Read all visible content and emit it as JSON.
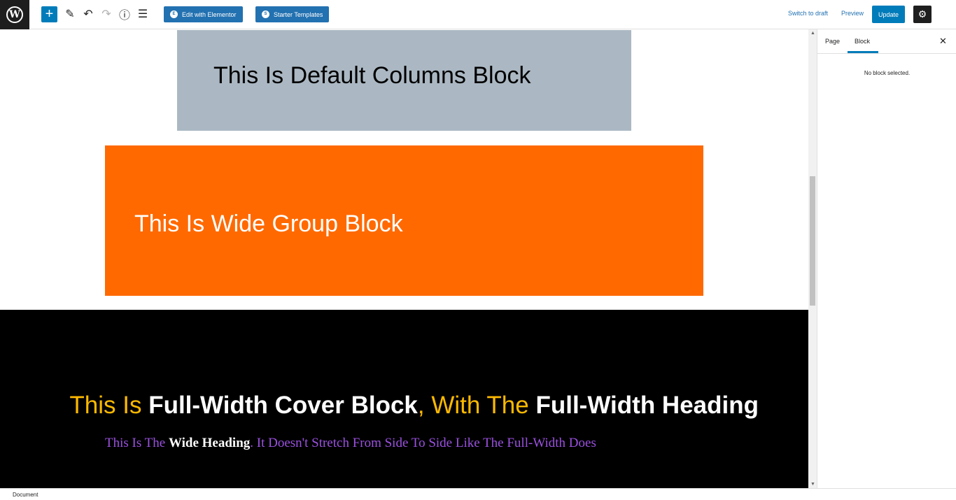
{
  "toolbar": {
    "logo": "W",
    "inserter_icon": "+",
    "tools_icon": "✎",
    "undo_icon": "↶",
    "redo_icon": "↷",
    "details_icon": "ⓘ",
    "list_view_icon": "☰",
    "elementor_label": "Edit with Elementor",
    "elementor_badge": "E",
    "starter_templates_label": "Starter Templates",
    "starter_templates_badge": "S",
    "switch_to_draft": "Switch to draft",
    "preview": "Preview",
    "update": "Update",
    "settings_icon": "⚙"
  },
  "canvas": {
    "columns_heading": "This Is Default Columns Block",
    "group_heading": "This Is Wide Group Block",
    "cover_heading": {
      "part1": "This Is ",
      "part2": "Full-Width Cover Block",
      "part3": ", With The ",
      "part4": "Full-Width Heading"
    },
    "cover_sub": {
      "part1": "This Is The ",
      "part2": "Wide Heading",
      "part3": ". It Doesn't Stretch From Side To Side Like The Full-Width Does"
    }
  },
  "colors": {
    "columns_bg": "#abb8c3",
    "group_bg": "#ff6900",
    "cover_bg": "#000000",
    "amber": "#fcb900",
    "purple": "#9b51e0",
    "primary": "#007cba"
  },
  "sidebar": {
    "tab_page": "Page",
    "tab_block": "Block",
    "close_icon": "✕",
    "empty_message": "No block selected."
  },
  "scrollbar": {
    "up_arrow": "▲",
    "down_arrow": "▼"
  },
  "footer": {
    "breadcrumb": "Document"
  }
}
